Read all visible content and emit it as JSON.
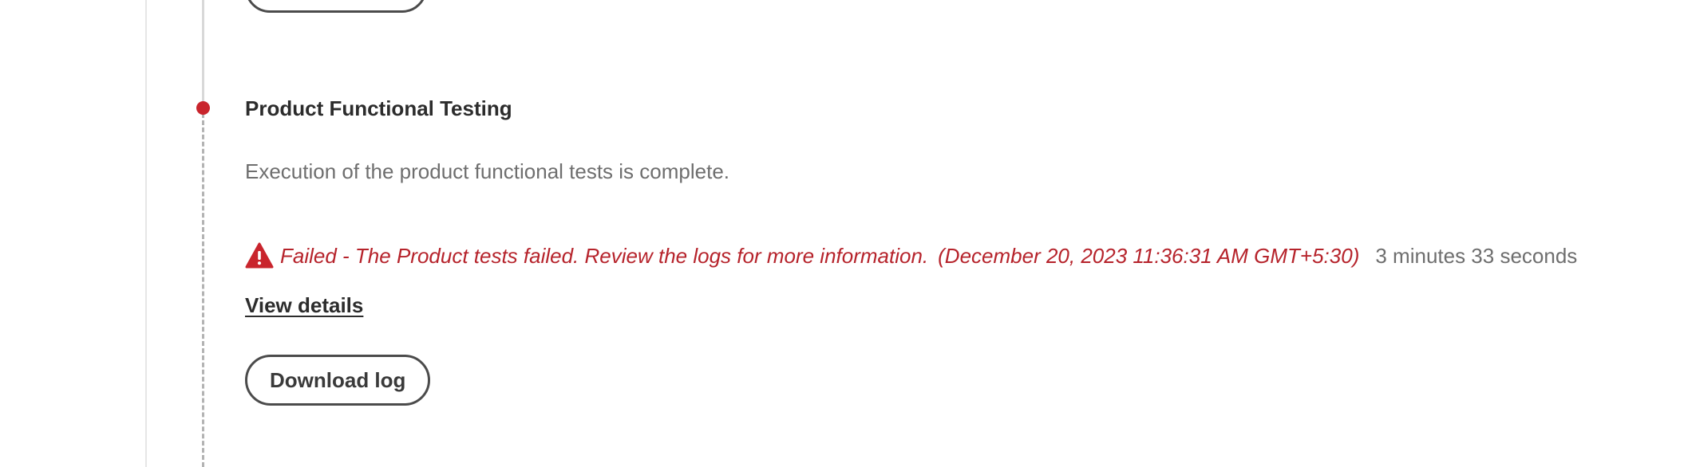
{
  "step": {
    "title": "Product Functional Testing",
    "description": "Execution of the product functional tests is complete.",
    "status": {
      "icon": "warning-icon",
      "message": "Failed - The Product tests failed. Review the logs for more information.",
      "timestamp": "(December 20, 2023 11:36:31 AM GMT+5:30)",
      "duration": "3 minutes 33 seconds",
      "color": "#b6232b"
    },
    "view_details_label": "View details",
    "download_log_label": "Download log"
  },
  "colors": {
    "error_red": "#c9252d",
    "text_dark": "#2c2c2c",
    "text_muted": "#6e6e6e"
  }
}
